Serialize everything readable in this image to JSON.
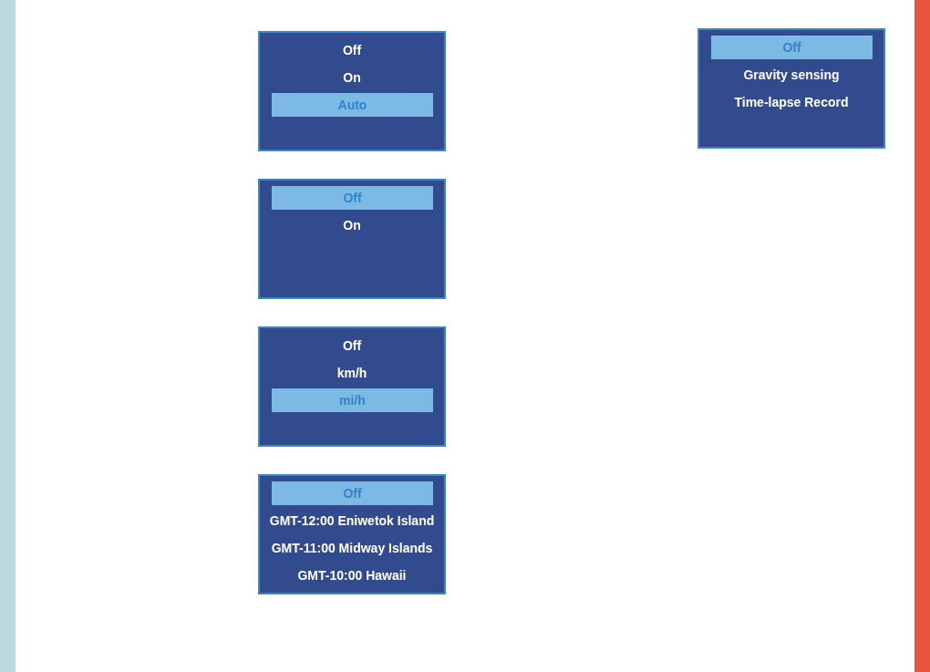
{
  "columns": [
    {
      "menus": [
        {
          "options": [
            {
              "label": "Off",
              "selected": false
            },
            {
              "label": "On",
              "selected": false
            },
            {
              "label": "Auto",
              "selected": true
            }
          ]
        },
        {
          "options": [
            {
              "label": "Off",
              "selected": true
            },
            {
              "label": "On",
              "selected": false
            }
          ]
        },
        {
          "options": [
            {
              "label": "Off",
              "selected": false
            },
            {
              "label": "km/h",
              "selected": false
            },
            {
              "label": "mi/h",
              "selected": true
            }
          ]
        },
        {
          "options": [
            {
              "label": "Off",
              "selected": true
            },
            {
              "label": "GMT-12:00 Eniwetok Island",
              "selected": false
            },
            {
              "label": "GMT-11:00 Midway Islands",
              "selected": false
            },
            {
              "label": "GMT-10:00 Hawaii",
              "selected": false
            }
          ]
        }
      ]
    },
    {
      "menus": [
        {
          "options": [
            {
              "label": "Off",
              "selected": true
            },
            {
              "label": "Gravity sensing",
              "selected": false
            },
            {
              "label": "Time-lapse Record",
              "selected": false
            }
          ]
        }
      ]
    }
  ]
}
